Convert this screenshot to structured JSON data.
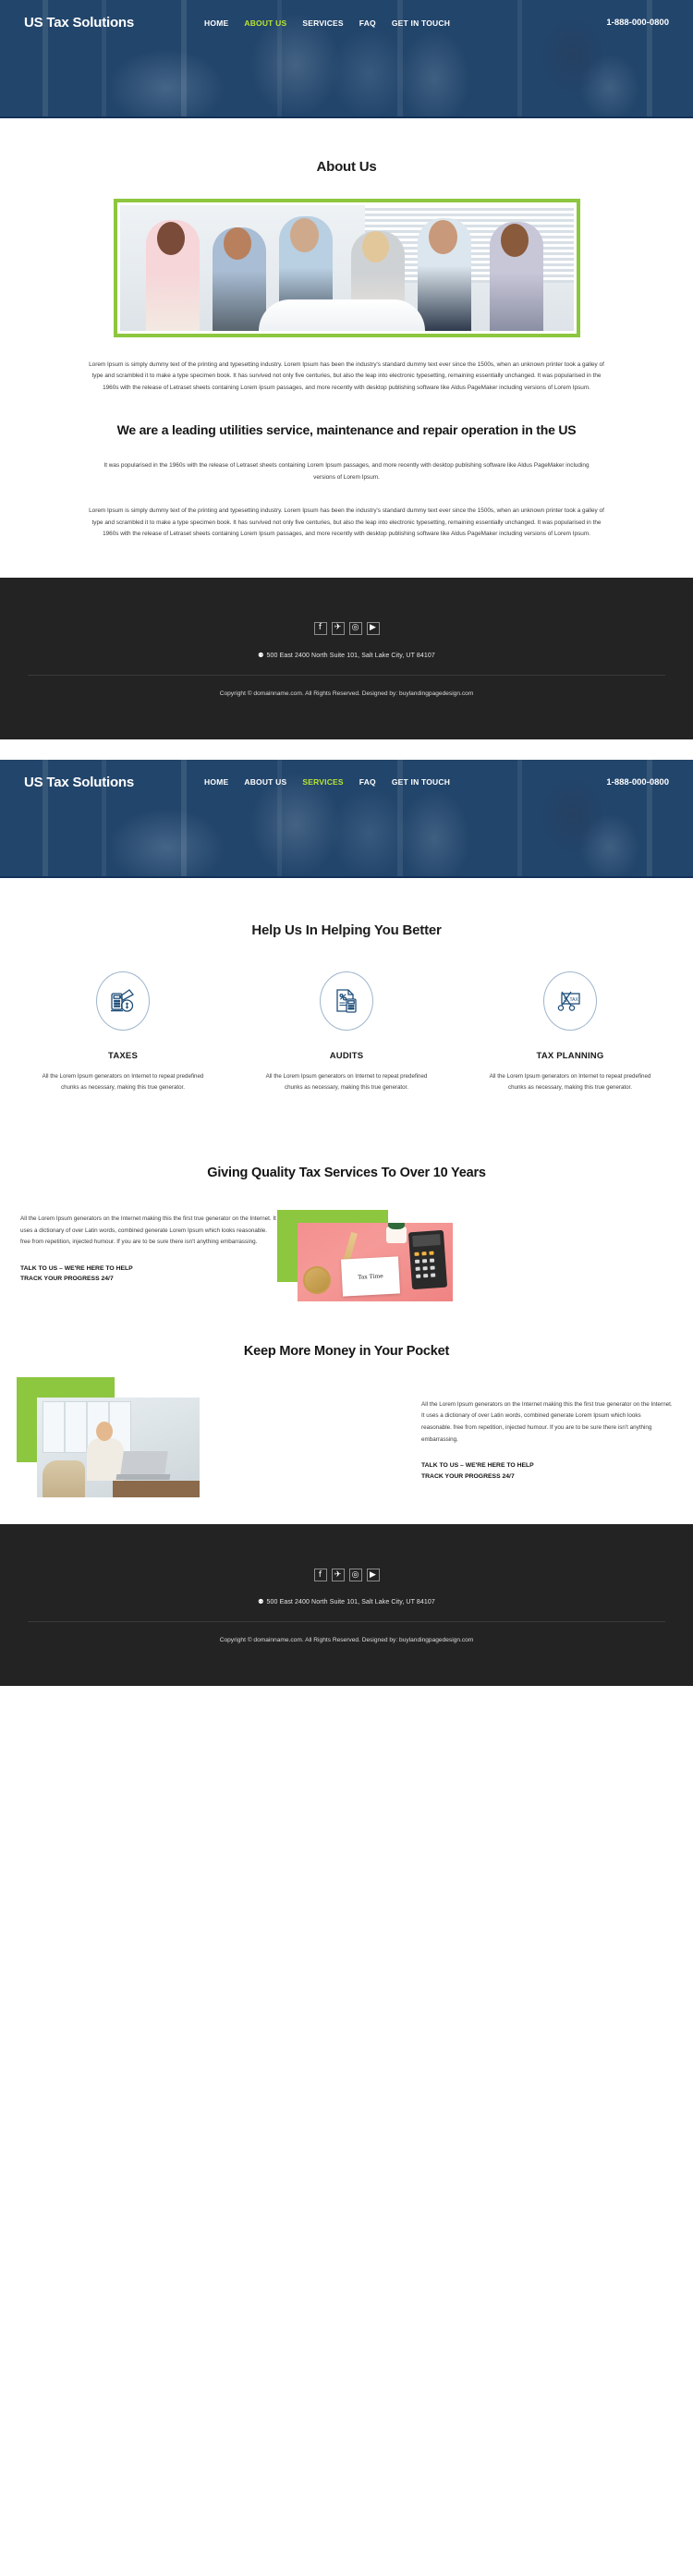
{
  "site": {
    "logo": "US Tax Solutions",
    "phone": "1-888-000-0800",
    "accent_green": "#8dc63f",
    "nav_active_green": "#b9e533",
    "header_blue": "#1b3a5c",
    "footer_dark": "#232323"
  },
  "nav_about": {
    "items": [
      {
        "label": "HOME",
        "active": false
      },
      {
        "label": "ABOUT US",
        "active": true
      },
      {
        "label": "SERVICES",
        "active": false
      },
      {
        "label": "FAQ",
        "active": false
      },
      {
        "label": "GET IN TOUCH",
        "active": false
      }
    ]
  },
  "nav_services": {
    "items": [
      {
        "label": "HOME",
        "active": false
      },
      {
        "label": "ABOUT US",
        "active": false
      },
      {
        "label": "SERVICES",
        "active": true
      },
      {
        "label": "FAQ",
        "active": false
      },
      {
        "label": "GET IN TOUCH",
        "active": false
      }
    ]
  },
  "about": {
    "title": "About Us",
    "paragraph1": "Lorem Ipsum is simply dummy text of the printing and typesetting industry. Lorem Ipsum has been the industry's standard dummy text ever since the 1500s, when an unknown printer took a galley of type and scrambled it to make a type specimen book. It has survived not only five centuries, but also the leap into electronic typesetting, remaining essentially unchanged. It was popularised in the 1960s with the release of Letraset sheets containing Lorem Ipsum passages, and more recently with desktop publishing software like Aldus PageMaker including versions of Lorem Ipsum.",
    "heading": "We are a leading utilities service, maintenance and repair operation in the US",
    "paragraph2": "It was popularised in the 1960s with the release of Letraset sheets containing Lorem Ipsum passages, and more recently with desktop publishing software like Aldus PageMaker including versions of Lorem Ipsum.",
    "paragraph3": "Lorem Ipsum is simply dummy text of the printing and typesetting industry. Lorem Ipsum has been the industry's standard dummy text ever since the 1500s, when an unknown printer took a galley of type and scrambled it to make a type specimen book. It has survived not only five centuries, but also the leap into electronic typesetting, remaining essentially unchanged. It was popularised in the 1960s with the release of Letraset sheets containing Lorem Ipsum passages, and more recently with desktop publishing software like Aldus PageMaker including versions of Lorem Ipsum."
  },
  "footer": {
    "social": [
      {
        "name": "facebook-icon",
        "glyph": "f"
      },
      {
        "name": "twitter-icon",
        "glyph": "✈"
      },
      {
        "name": "instagram-icon",
        "glyph": "◎"
      },
      {
        "name": "youtube-icon",
        "glyph": "▶"
      }
    ],
    "pin_glyph": "⚉",
    "address": "500 East 2400 North Suite 101, Salt Lake City, UT 84107",
    "copyright": "Copyright © domainname.com. All Rights Reserved. Designed by: buylandingpagedesign.com"
  },
  "services": {
    "title": "Help Us In Helping You Better",
    "items": [
      {
        "icon": "calculator-money-icon",
        "name": "TAXES",
        "desc": "All the Lorem Ipsum generators on Internet to repeat predefined chunks as necessary, making this true generator."
      },
      {
        "icon": "document-calculator-icon",
        "name": "AUDITS",
        "desc": "All the Lorem Ipsum generators on Internet to repeat predefined chunks as necessary, making this true generator."
      },
      {
        "icon": "scissors-tax-icon",
        "name": "TAX PLANNING",
        "desc": "All the Lorem Ipsum generators on Internet to repeat predefined chunks as necessary, making this true generator."
      }
    ]
  },
  "promo1": {
    "title": "Giving Quality Tax Services To Over 10 Years",
    "paragraph": "All the Lorem Ipsum generators on the Internet making this the first true generator on the Internet. It uses a dictionary of over Latin words, combined generate Lorem Ipsum which looks reasonable. free from repetition, injected humour. If you are to be sure there isn't anything embarrassing.",
    "cta_line1": "TALK TO US – WE'RE HERE TO HELP",
    "cta_line2": "TRACK YOUR PROGRESS 24/7",
    "image_note_text": "Tax Time"
  },
  "promo2": {
    "title": "Keep More Money in Your Pocket",
    "paragraph": "All the Lorem Ipsum generators on the Internet making this the first true generator on the Internet. It uses a dictionary of over Latin words, combined generate Lorem Ipsum which looks reasonable. free from repetition, injected humour. If you are to be sure there isn't anything embarrassing.",
    "cta_line1": "TALK TO US – WE'RE HERE TO HELP",
    "cta_line2": "TRACK YOUR PROGRESS 24/7"
  }
}
